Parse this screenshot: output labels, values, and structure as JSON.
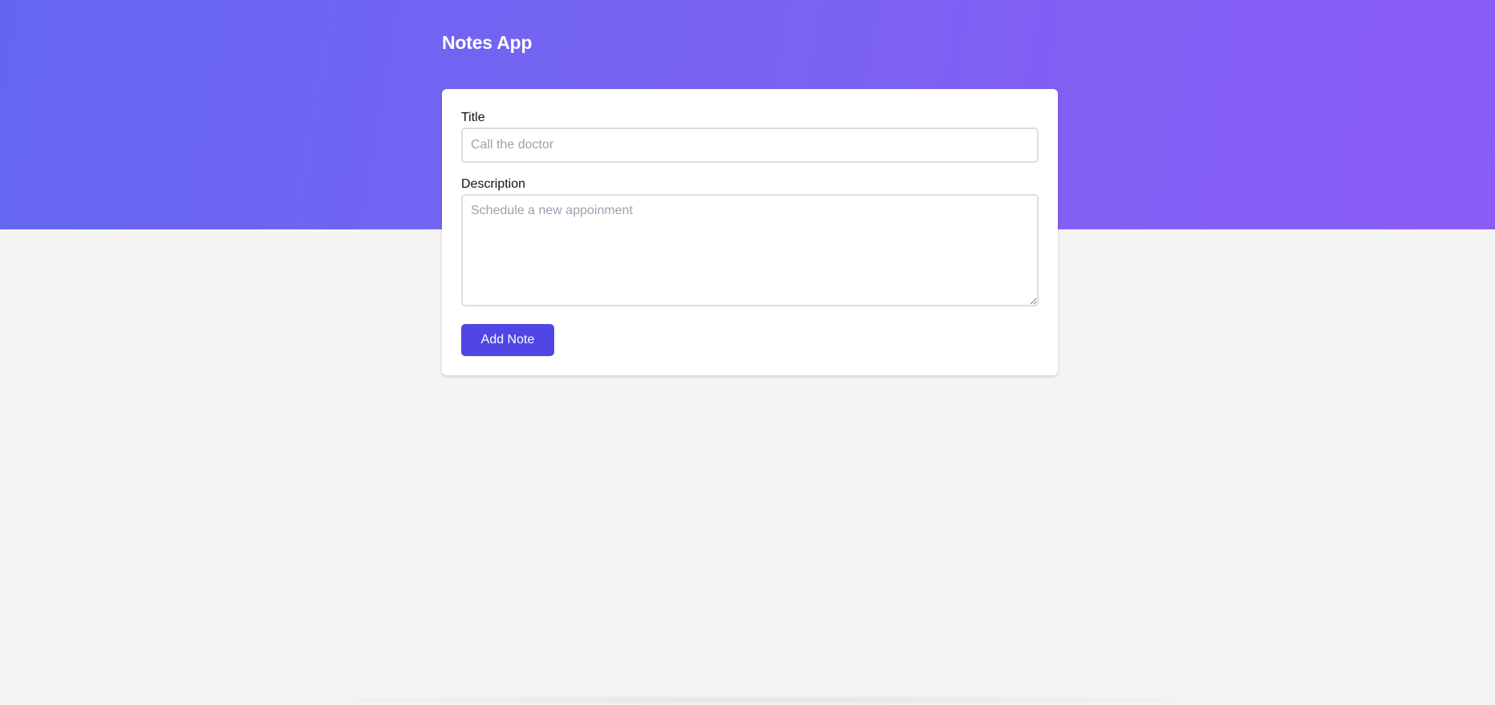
{
  "app": {
    "title": "Notes App"
  },
  "form": {
    "title_label": "Title",
    "title_placeholder": "Call the doctor",
    "title_value": "",
    "description_label": "Description",
    "description_placeholder": "Schedule a new appoinment",
    "description_value": "",
    "submit_label": "Add Note"
  },
  "colors": {
    "hero_gradient_start": "#6466f1",
    "hero_gradient_end": "#8b5cf6",
    "button": "#4f46e5",
    "page_background": "#f4f4f2"
  }
}
